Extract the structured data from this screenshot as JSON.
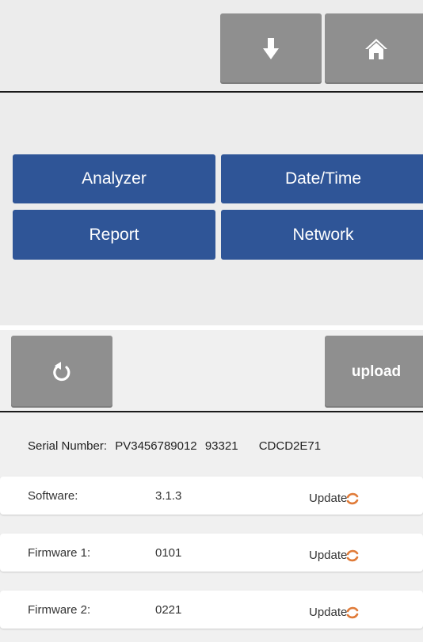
{
  "toolbar_top": {
    "download_icon": "arrow-down-icon",
    "home_icon": "home-icon"
  },
  "menu": {
    "analyzer": "Analyzer",
    "datetime": "Date/Time",
    "report": "Report",
    "network": "Network"
  },
  "toolbar_bottom": {
    "reset_icon": "refresh-icon",
    "upload_label": "upload"
  },
  "serial": {
    "label": "Serial Number:",
    "value1": "PV3456789012",
    "value2": "93321",
    "value3": "CDCD2E71"
  },
  "rows": [
    {
      "label": "Software:",
      "value": "3.1.3",
      "action": "Update"
    },
    {
      "label": "Firmware 1:",
      "value": "0101",
      "action": "Update"
    },
    {
      "label": "Firmware 2:",
      "value": "0221",
      "action": "Update"
    }
  ],
  "colors": {
    "menu_blue": "#2f5597",
    "toolbar_gray": "#8f8f8f",
    "update_icon": "#e07b39"
  }
}
